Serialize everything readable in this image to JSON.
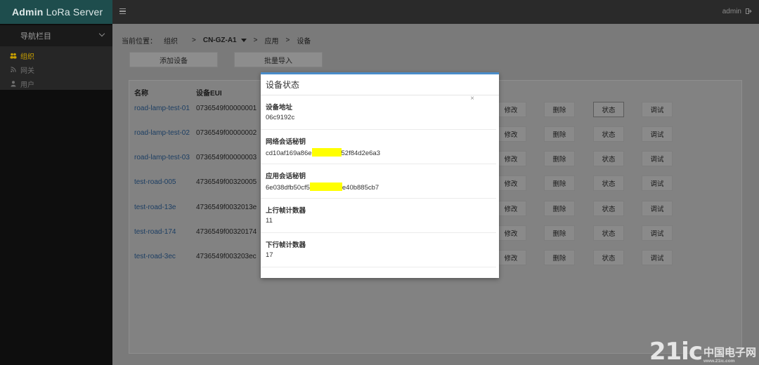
{
  "app": {
    "title_bold": "Admin",
    "title_rest": "LoRa Server"
  },
  "topbar": {
    "user": "admin"
  },
  "sidebar": {
    "section_title": "导航栏目",
    "items": [
      {
        "label": "组织",
        "icon": "users-icon",
        "active": true
      },
      {
        "label": "网关",
        "icon": "rss-icon",
        "active": false
      },
      {
        "label": "用户",
        "icon": "user-icon",
        "active": false
      }
    ]
  },
  "breadcrumb": {
    "prefix": "当前位置：",
    "org": "组织",
    "sep": ">",
    "gateway": "CN-GZ-A1",
    "apps": "应用",
    "devices": "设备"
  },
  "toolbar": {
    "add_device": "添加设备",
    "bulk_import": "批量导入"
  },
  "table": {
    "headers": {
      "name": "名称",
      "eui": "设备EUI"
    },
    "rows": [
      {
        "name": "road-lamp-test-01",
        "eui": "0736549f00000001"
      },
      {
        "name": "road-lamp-test-02",
        "eui": "0736549f00000002"
      },
      {
        "name": "road-lamp-test-03",
        "eui": "0736549f00000003"
      },
      {
        "name": "test-road-005",
        "eui": "4736549f00320005"
      },
      {
        "name": "test-road-13e",
        "eui": "4736549f0032013e"
      },
      {
        "name": "test-road-174",
        "eui": "4736549f00320174"
      },
      {
        "name": "test-road-3ec",
        "eui": "4736549f003203ec"
      }
    ],
    "actions": {
      "edit": "修改",
      "delete": "删除",
      "status": "状态",
      "debug": "调试"
    }
  },
  "modal": {
    "title": "设备状态",
    "close": "×",
    "fields": [
      {
        "label": "设备地址",
        "value": "06c9192c"
      },
      {
        "label": "网络会话秘钥",
        "value_start": "cd10af169a86e",
        "value_end": "52f84d2e6a3"
      },
      {
        "label": "应用会话秘钥",
        "value_start": "6e038dfb50cf5",
        "value_end": "e40b885cb7"
      },
      {
        "label": "上行帧计数器",
        "value": "11"
      },
      {
        "label": "下行帧计数器",
        "value": "17"
      }
    ]
  },
  "watermark": {
    "logo": "21ic",
    "cn": "中国电子网",
    "url": "www.21ic.com"
  },
  "colors": {
    "brand": "#1e4d4d",
    "active_nav": "#c9a000",
    "modal_accent": "#4a8cc9",
    "redaction": "#ffff00",
    "link": "#1c3e63"
  }
}
